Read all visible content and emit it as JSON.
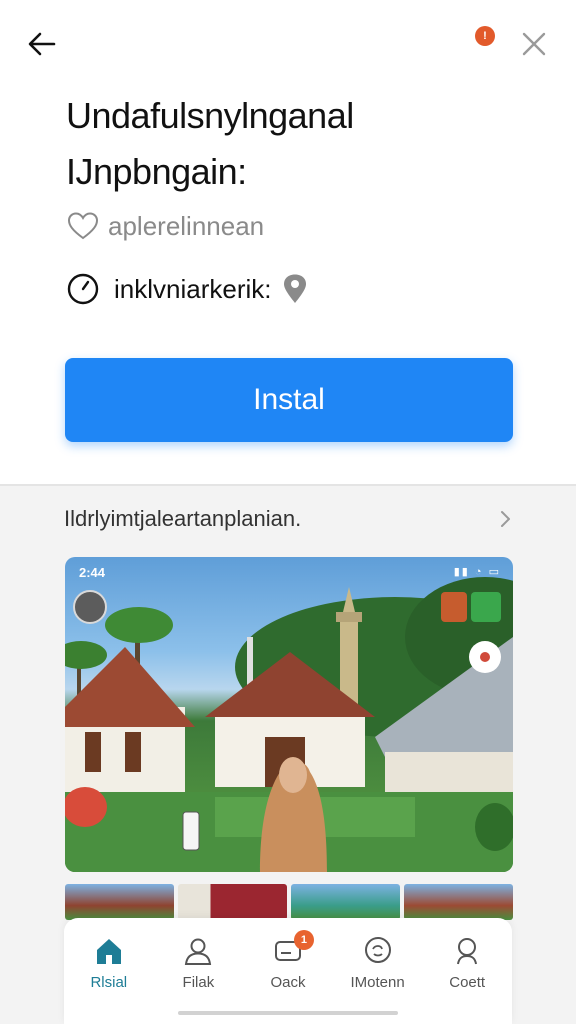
{
  "header": {
    "notification_count": "!"
  },
  "app": {
    "title_line1": "Undafulsnylnganal",
    "title_line2": "IJnpbngain:",
    "favorite_label": "aplerelinnean",
    "rating_label": "inklvniarkerik:",
    "install_label": "Instal"
  },
  "section": {
    "title": "Ildrlyimtjaleartanplanian."
  },
  "screenshot": {
    "time": "2:44",
    "status_icons": "▮▮ ◔ ▭",
    "colors": {
      "sky": "#6aa8e0",
      "roof": "#9c4a33",
      "grass": "#4e8f3f"
    }
  },
  "bottom_nav": {
    "items": [
      {
        "label": "Rlsial",
        "icon": "home-icon",
        "active": true
      },
      {
        "label": "Filak",
        "icon": "person-icon",
        "active": false
      },
      {
        "label": "Oack",
        "icon": "card-icon",
        "active": false,
        "badge": "1"
      },
      {
        "label": "IMotenn",
        "icon": "chat-icon",
        "active": false
      },
      {
        "label": "Coett",
        "icon": "search-icon",
        "active": false
      }
    ]
  },
  "colors": {
    "accent": "#1f86f5",
    "nav_active": "#1e7d96",
    "badge": "#e25a2b"
  }
}
